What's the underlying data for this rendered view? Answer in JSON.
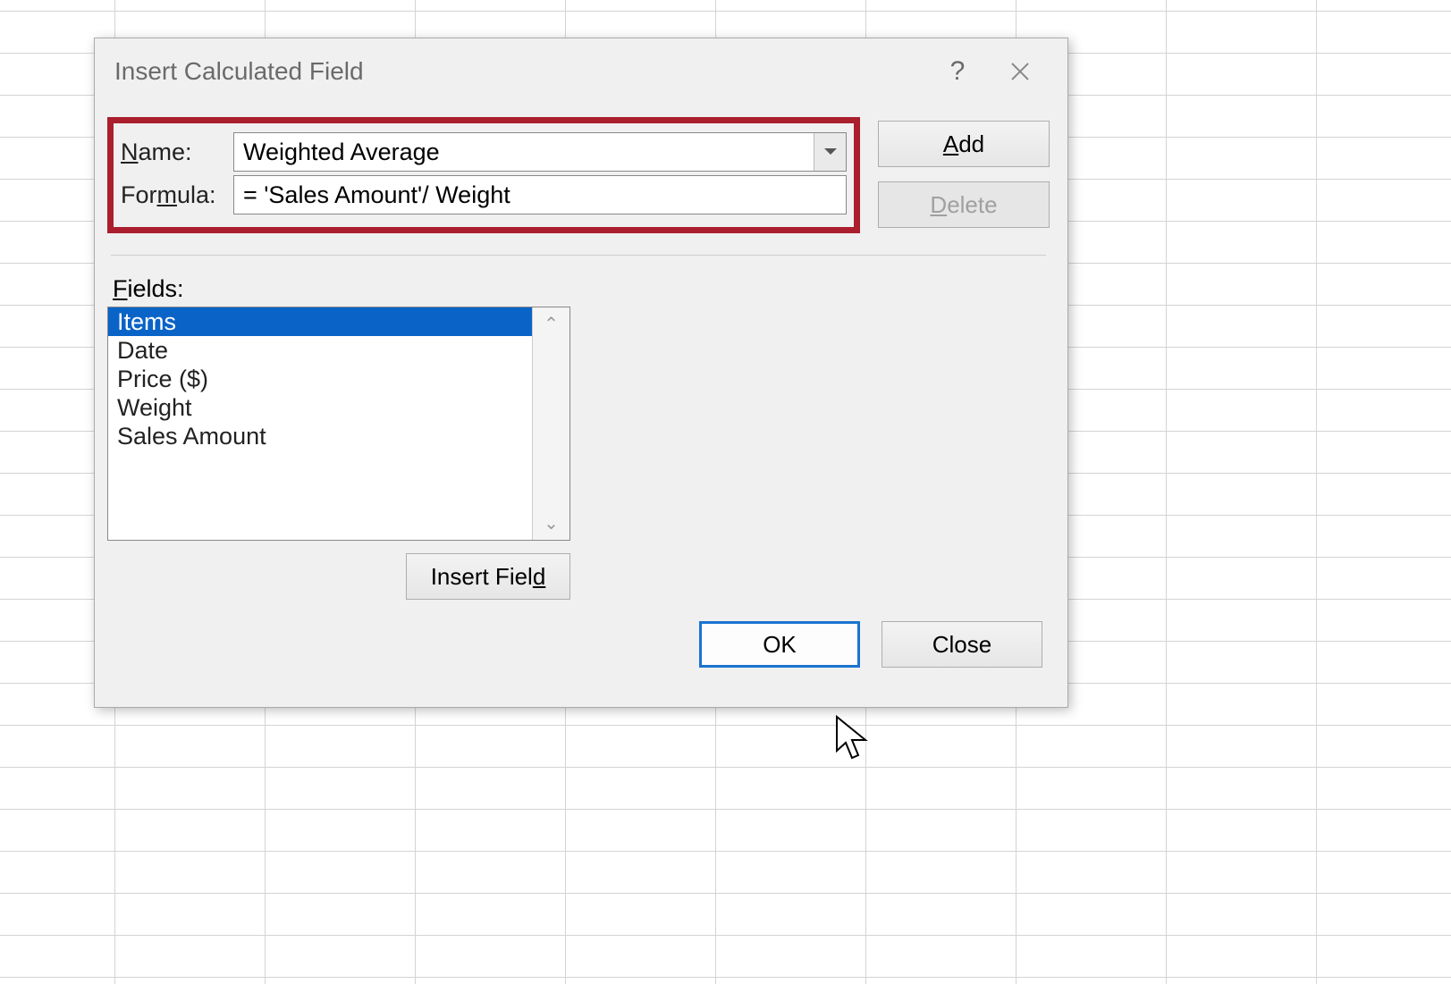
{
  "dialog": {
    "title": "Insert Calculated Field",
    "help_icon": "?",
    "name_label_pre": "N",
    "name_label_post": "ame:",
    "name_value": "Weighted Average",
    "formula_label_pre": "For",
    "formula_label_mid": "m",
    "formula_label_post": "ula:",
    "formula_value": "= 'Sales Amount'/ Weight",
    "add_pre": "A",
    "add_post": "dd",
    "delete_pre": "D",
    "delete_post": "elete",
    "fields_label_pre": "F",
    "fields_label_post": "ields:",
    "fields": [
      "Items",
      "Date",
      "Price ($)",
      "Weight",
      "Sales Amount"
    ],
    "selected_field_index": 0,
    "insert_field": "Insert Fiel",
    "insert_field_ul": "d",
    "ok": "OK",
    "close": "Close"
  }
}
